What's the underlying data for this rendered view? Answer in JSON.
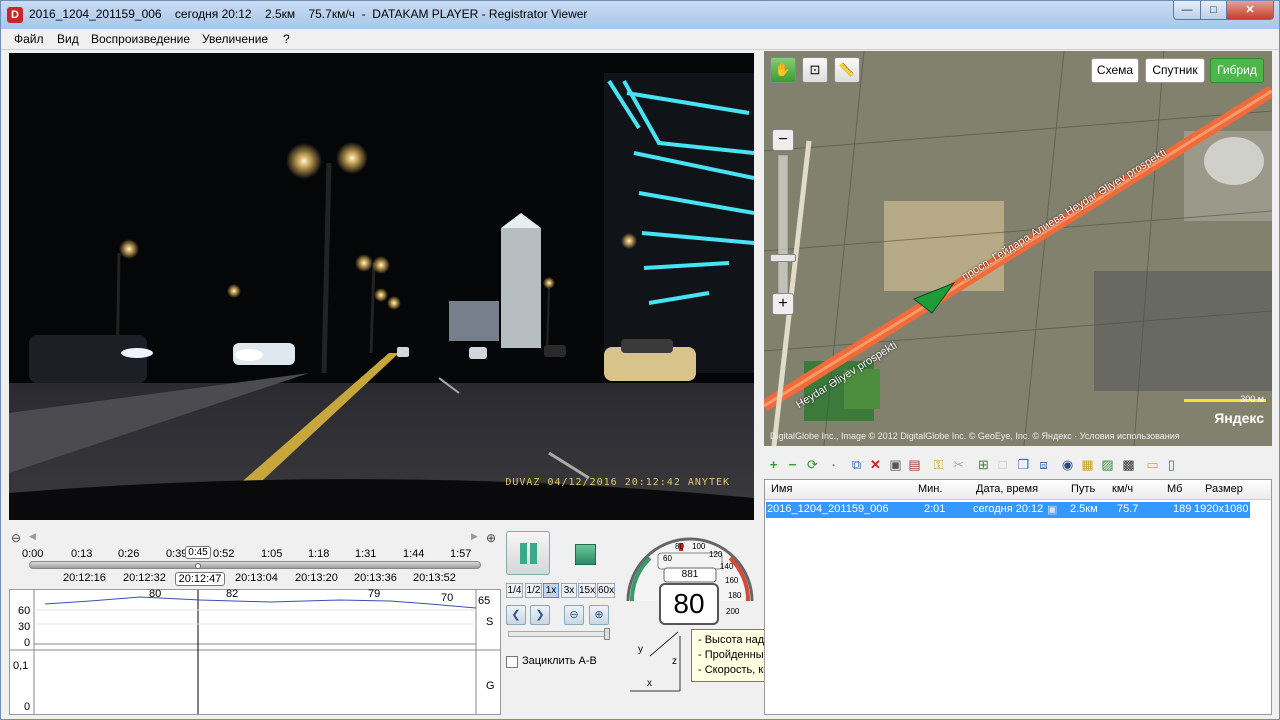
{
  "window": {
    "title": "2016_1204_201159_006    сегодня 20:12    2.5км    75.7км/ч  -  DATAKAM PLAYER - Registrator Viewer",
    "controls": {
      "minimize": "—",
      "maximize": "□",
      "close": "✕"
    }
  },
  "menu": [
    "Файл",
    "Вид",
    "Воспроизведение",
    "Увеличение",
    "?"
  ],
  "video": {
    "osd": "DUVAZ 04/12/2016 20:12:42 ANYTEK"
  },
  "timeline": {
    "ticks_top": [
      "0:00",
      "0:13",
      "0:26",
      "0:39",
      "0:52",
      "1:05",
      "1:18",
      "1:31",
      "1:44",
      "1:57"
    ],
    "position_top": "0:45",
    "ticks_bottom": [
      "20:12:16",
      "20:12:32",
      "20:13:04",
      "20:13:20",
      "20:13:36",
      "20:13:52"
    ],
    "position_bottom": "20:12:47",
    "zoom_out": "⊖",
    "zoom_in": "⊕"
  },
  "graph_speed": {
    "y_ticks": [
      "60",
      "30",
      "0"
    ],
    "markers": [
      "80",
      "82",
      "79",
      "70",
      "65"
    ],
    "label": "S"
  },
  "graph_g": {
    "y_ticks": [
      "0,1",
      "0"
    ],
    "label": "G"
  },
  "controls": {
    "speeds": [
      "1/4",
      "1/2",
      "1x",
      "3x",
      "15x",
      "60x"
    ],
    "active_speed": "1x",
    "nav": {
      "prev": "❮",
      "next": "❯",
      "zoom_out": "⊖",
      "zoom_in": "⊕"
    },
    "loop_label": "Зациклить А-В"
  },
  "gauge": {
    "speed": "80",
    "altitude": "881",
    "ticks": [
      "60",
      "80",
      "100",
      "120",
      "140",
      "160",
      "180",
      "200"
    ],
    "axes": {
      "x": "x",
      "y": "y",
      "z": "z"
    },
    "tooltip": [
      "- Высота над уровнем моря, м",
      "- Пройденный путь, м",
      "- Скорость, км/ч"
    ]
  },
  "map": {
    "tools": [
      "✋",
      "⊡",
      "📏"
    ],
    "types": [
      "Схема",
      "Спутник",
      "Гибрид"
    ],
    "active_type": "Гибрид",
    "zoom_minus": "−",
    "zoom_plus": "+",
    "street_labels": [
      "просп. Гейдара Алиева Heydar Əliyev prospekti",
      "Heydar Əliyev prospekti"
    ],
    "scale": "300 м",
    "logo": "Яндекс",
    "attribution": "DigitalGlobe Inc., Image © 2012 DigitalGlobe Inc. © GeoEye, Inc. © Яндекс · Условия использования"
  },
  "toolbar_icons": [
    "add",
    "remove",
    "refresh",
    "dot",
    "copy",
    "delete",
    "save",
    "export",
    "key",
    "cut",
    "new",
    "select",
    "copy-multi",
    "merge",
    "globe",
    "chart",
    "image",
    "film",
    "folder",
    "doc"
  ],
  "file_table": {
    "columns": [
      "Имя",
      "Мин.",
      "Дата, время",
      "Путь",
      "км/ч",
      "Мб",
      "Размер"
    ],
    "rows": [
      {
        "name": "2016_1204_201159_006",
        "min": "2:01",
        "datetime": "сегодня 20:12",
        "path": "2.5км",
        "speed": "75.7",
        "mb": "189",
        "size": "1920x1080"
      }
    ]
  },
  "colors": {
    "accent": "#3399ff",
    "map_active": "#4cb748",
    "route": "#f06a3a"
  }
}
